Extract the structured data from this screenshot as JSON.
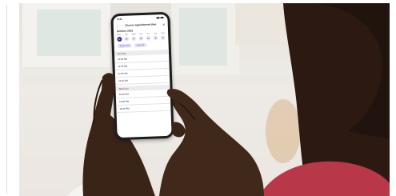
{
  "photo": {
    "description_icon": "photo-icon"
  },
  "phone": {
    "status": {
      "time": "9:41"
    },
    "header": {
      "title": "Choose appointment time",
      "back_icon": "‹",
      "close_icon": "✕"
    },
    "month": "October 2021",
    "days": [
      {
        "label": "Mon",
        "num": "25"
      },
      {
        "label": "Tue",
        "num": "26"
      },
      {
        "label": "Wed",
        "num": "27"
      },
      {
        "label": "Thu",
        "num": "28"
      },
      {
        "label": "Fri",
        "num": "29"
      },
      {
        "label": "Sat",
        "num": "30"
      },
      {
        "label": "Sun",
        "num": "31"
      }
    ],
    "chips": {
      "first": "Earliest slot",
      "second": "Next slot"
    },
    "sections": {
      "morning": "Morning",
      "afternoon": "Afternoon"
    },
    "morning_slots": [
      "11:30 AM",
      "11:45 AM",
      "11:45 AM",
      "11:45 AM"
    ],
    "afternoon_slots": [
      "12:30 PM",
      "12:30 PM",
      "12:45 PM"
    ],
    "chevron": "›"
  },
  "colors": {
    "accent": "#3b2a8f",
    "accent_light": "#e7e0fb",
    "skin_dark": "#3a2418",
    "shirt": "#b8384a"
  }
}
